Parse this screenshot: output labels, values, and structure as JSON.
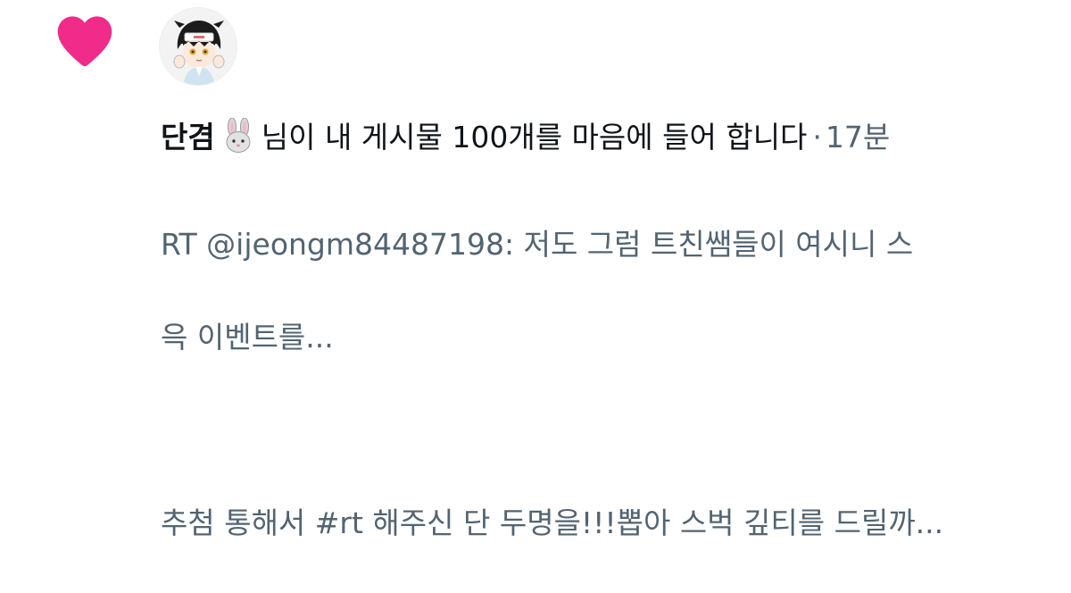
{
  "notification": {
    "type_icon": "heart-icon",
    "accent_color": "#f02b8a",
    "avatar_icon": "profile-avatar",
    "username": "단겸",
    "username_emoji_icon": "rabbit-face-icon",
    "action_text": "님이 내 게시물 100개를 마음에 들어 합니다",
    "separator": "·",
    "time": "17분",
    "preview_lines": [
      "RT @ijeongm84487198: 저도 그럼 트친쌤들이 여시니 스",
      "윽 이벤트를...",
      "",
      "추첨 통해서 #rt 해주신 단 두명을!!!뽑아 스벅 깊티를 드릴까..."
    ]
  }
}
